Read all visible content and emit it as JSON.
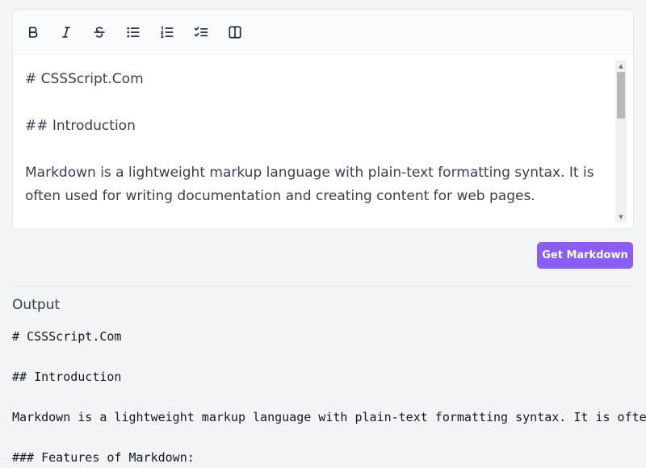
{
  "toolbar": {
    "buttons": [
      {
        "name": "bold-icon",
        "title": "Bold"
      },
      {
        "name": "italic-icon",
        "title": "Italic"
      },
      {
        "name": "strikethrough-icon",
        "title": "Strikethrough"
      },
      {
        "name": "bullet-list-icon",
        "title": "Bullet List"
      },
      {
        "name": "ordered-list-icon",
        "title": "Ordered List"
      },
      {
        "name": "task-list-icon",
        "title": "Task List"
      },
      {
        "name": "split-view-icon",
        "title": "Split View"
      }
    ]
  },
  "editor": {
    "lines": [
      "# CSSScript.Com",
      "## Introduction",
      "Markdown is a lightweight markup language with plain-text formatting syntax. It is often used for writing documentation and creating content for web pages."
    ]
  },
  "actions": {
    "get_markdown_label": "Get Markdown"
  },
  "output": {
    "heading": "Output",
    "text": "# CSSScript.Com\n\n## Introduction\n\nMarkdown is a lightweight markup language with plain-text formatting syntax. It is often used for writing documentation and creating content for web pages.\n\n### Features of Markdown:"
  },
  "colors": {
    "accent": "#8b5cf6",
    "page_background": "#f3f4f6",
    "text": "#374151"
  }
}
